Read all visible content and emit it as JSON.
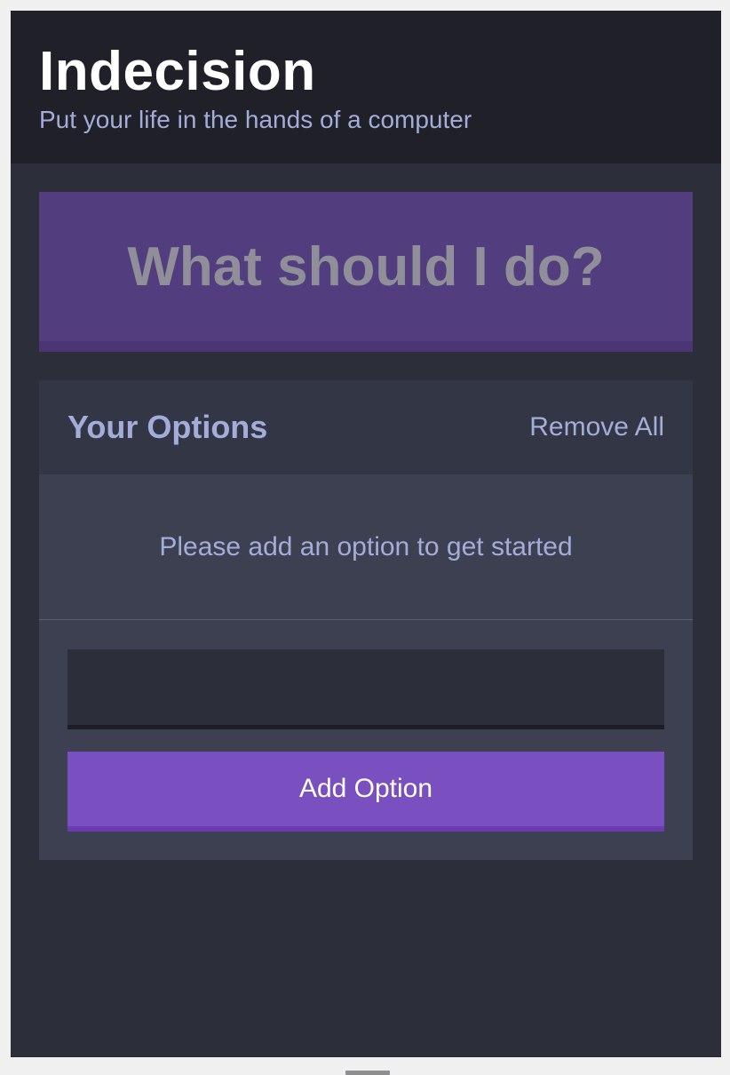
{
  "header": {
    "title": "Indecision",
    "subtitle": "Put your life in the hands of a computer"
  },
  "action": {
    "label": "What should I do?"
  },
  "options_widget": {
    "title": "Your Options",
    "remove_all_label": "Remove All",
    "empty_message": "Please add an option to get started"
  },
  "add_option": {
    "input_value": "",
    "placeholder": "",
    "button_label": "Add Option"
  },
  "colors": {
    "background": "#2c2e3a",
    "header": "#1f2028",
    "action_button": "#523e7e",
    "primary_button": "#7a4fbf",
    "text_accent": "#a4acd9"
  }
}
